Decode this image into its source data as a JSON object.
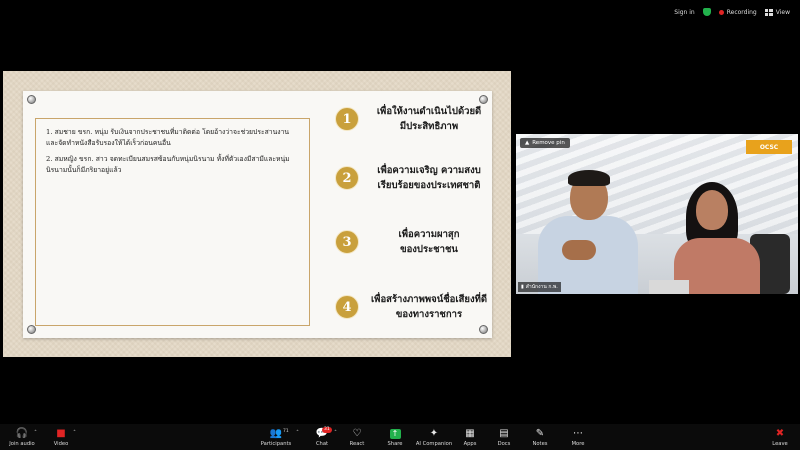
{
  "topbar": {
    "sign_in": "Sign in",
    "recording": "Recording",
    "view": "View"
  },
  "slide": {
    "left_items": [
      "1. สมชาย ขรก. หนุ่ม รับเงินจากประชาชนที่มาติดต่อ โดยอ้างว่าจะช่วยประสานงานและจัดทำหนังสือรับรองให้ได้เร็วก่อนคนอื่น",
      "2. สมหญิง ขรก. สาว จดทะเบียนสมรสซ้อนกับหนุ่มนิรนาม ทั้งที่ตัวเองมีสามีและหนุ่มนิรนามนั้นก็มีภริยาอยู่แล้ว"
    ],
    "points": [
      {
        "num": "1",
        "line1": "เพื่อให้งานดำเนินไปด้วยดี",
        "line2": "มีประสิทธิภาพ"
      },
      {
        "num": "2",
        "line1": "เพื่อความเจริญ ความสงบ",
        "line2": "เรียบร้อยของประเทศชาติ"
      },
      {
        "num": "3",
        "line1": "เพื่อความผาสุก",
        "line2": "ของประชาชน"
      },
      {
        "num": "4",
        "line1": "เพื่อสร้างภาพพจน์ชื่อเสียงที่ดี",
        "line2": "ของทางราชการ"
      }
    ]
  },
  "video": {
    "remove_pin": "Remove pin",
    "logo": "OCSC",
    "name_tag": "สำนักงาน ก.พ."
  },
  "toolbar": {
    "join_audio": "Join audio",
    "video": "Video",
    "participants": "Participants",
    "participants_count": "71",
    "chat": "Chat",
    "chat_badge": "31",
    "react": "React",
    "share": "Share",
    "ai_companion": "AI Companion",
    "apps": "Apps",
    "docs": "Docs",
    "notes": "Notes",
    "more": "More",
    "leave": "Leave"
  },
  "colors": {
    "accent_gold": "#c9a03c",
    "share_green": "#22b14c",
    "recording_red": "#e02424"
  }
}
